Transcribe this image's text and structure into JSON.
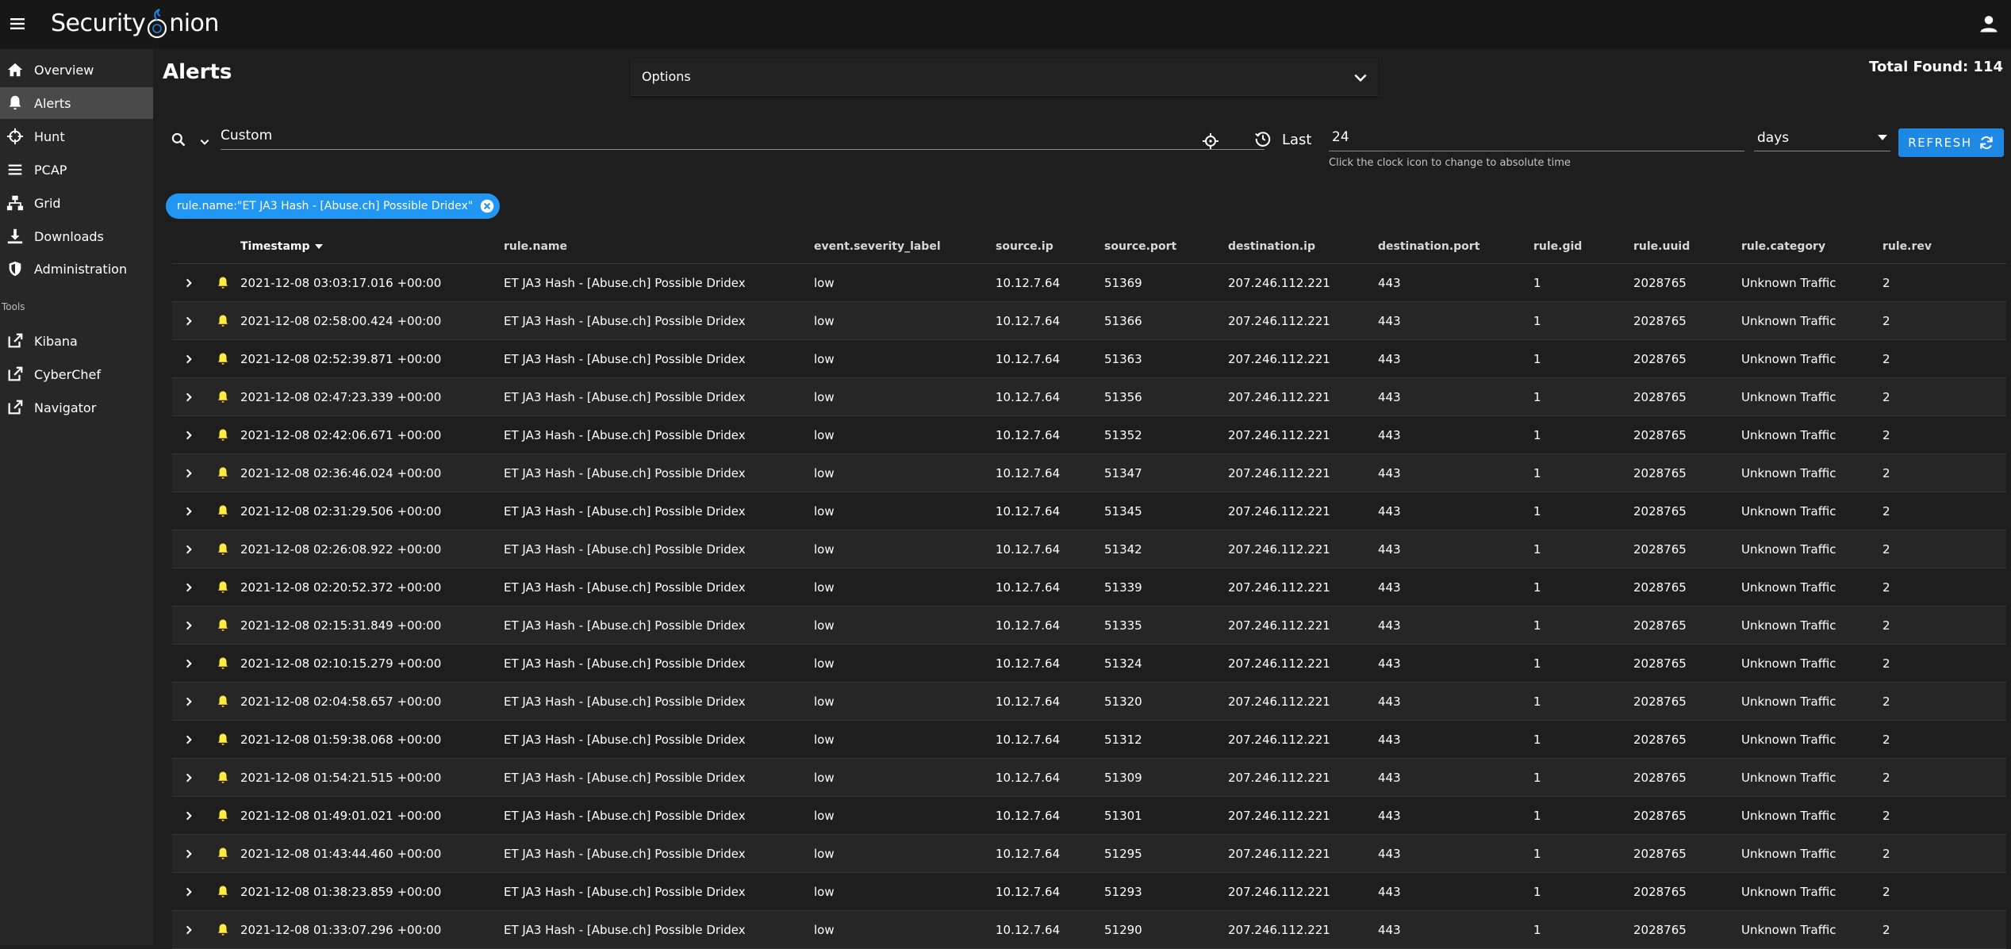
{
  "app": {
    "logo_text_left": "Security",
    "logo_text_right": "nion",
    "accent_color": "#1e88e5",
    "chip_color": "#2196f3",
    "bell_color": "#ffeb3b"
  },
  "sidebar": {
    "items": [
      {
        "label": "Overview",
        "icon": "home-icon"
      },
      {
        "label": "Alerts",
        "icon": "bell-icon",
        "active": true
      },
      {
        "label": "Hunt",
        "icon": "crosshairs-icon"
      },
      {
        "label": "PCAP",
        "icon": "list-icon"
      },
      {
        "label": "Grid",
        "icon": "sitemap-icon"
      },
      {
        "label": "Downloads",
        "icon": "download-icon"
      },
      {
        "label": "Administration",
        "icon": "shield-icon"
      }
    ],
    "tools_header": "Tools",
    "tools": [
      {
        "label": "Kibana",
        "icon": "external-link-icon"
      },
      {
        "label": "CyberChef",
        "icon": "external-link-icon"
      },
      {
        "label": "Navigator",
        "icon": "external-link-icon"
      }
    ]
  },
  "header": {
    "title": "Alerts",
    "options_label": "Options",
    "total_found": "Total Found: 114"
  },
  "query": {
    "value": "Custom",
    "last_label": "Last",
    "range_value": "24",
    "range_hint": "Click the clock icon to change to absolute time",
    "unit": "days",
    "refresh_label": "REFRESH"
  },
  "filter_chip": {
    "label": "rule.name:\"ET JA3 Hash - [Abuse.ch] Possible Dridex\""
  },
  "table": {
    "columns": [
      "Timestamp",
      "rule.name",
      "event.severity_label",
      "source.ip",
      "source.port",
      "destination.ip",
      "destination.port",
      "rule.gid",
      "rule.uuid",
      "rule.category",
      "rule.rev"
    ],
    "sorted_column": "Timestamp",
    "sort_direction": "descending",
    "rows": [
      [
        "2021-12-08 03:03:17.016 +00:00",
        "ET JA3 Hash - [Abuse.ch] Possible Dridex",
        "low",
        "10.12.7.64",
        "51369",
        "207.246.112.221",
        "443",
        "1",
        "2028765",
        "Unknown Traffic",
        "2"
      ],
      [
        "2021-12-08 02:58:00.424 +00:00",
        "ET JA3 Hash - [Abuse.ch] Possible Dridex",
        "low",
        "10.12.7.64",
        "51366",
        "207.246.112.221",
        "443",
        "1",
        "2028765",
        "Unknown Traffic",
        "2"
      ],
      [
        "2021-12-08 02:52:39.871 +00:00",
        "ET JA3 Hash - [Abuse.ch] Possible Dridex",
        "low",
        "10.12.7.64",
        "51363",
        "207.246.112.221",
        "443",
        "1",
        "2028765",
        "Unknown Traffic",
        "2"
      ],
      [
        "2021-12-08 02:47:23.339 +00:00",
        "ET JA3 Hash - [Abuse.ch] Possible Dridex",
        "low",
        "10.12.7.64",
        "51356",
        "207.246.112.221",
        "443",
        "1",
        "2028765",
        "Unknown Traffic",
        "2"
      ],
      [
        "2021-12-08 02:42:06.671 +00:00",
        "ET JA3 Hash - [Abuse.ch] Possible Dridex",
        "low",
        "10.12.7.64",
        "51352",
        "207.246.112.221",
        "443",
        "1",
        "2028765",
        "Unknown Traffic",
        "2"
      ],
      [
        "2021-12-08 02:36:46.024 +00:00",
        "ET JA3 Hash - [Abuse.ch] Possible Dridex",
        "low",
        "10.12.7.64",
        "51347",
        "207.246.112.221",
        "443",
        "1",
        "2028765",
        "Unknown Traffic",
        "2"
      ],
      [
        "2021-12-08 02:31:29.506 +00:00",
        "ET JA3 Hash - [Abuse.ch] Possible Dridex",
        "low",
        "10.12.7.64",
        "51345",
        "207.246.112.221",
        "443",
        "1",
        "2028765",
        "Unknown Traffic",
        "2"
      ],
      [
        "2021-12-08 02:26:08.922 +00:00",
        "ET JA3 Hash - [Abuse.ch] Possible Dridex",
        "low",
        "10.12.7.64",
        "51342",
        "207.246.112.221",
        "443",
        "1",
        "2028765",
        "Unknown Traffic",
        "2"
      ],
      [
        "2021-12-08 02:20:52.372 +00:00",
        "ET JA3 Hash - [Abuse.ch] Possible Dridex",
        "low",
        "10.12.7.64",
        "51339",
        "207.246.112.221",
        "443",
        "1",
        "2028765",
        "Unknown Traffic",
        "2"
      ],
      [
        "2021-12-08 02:15:31.849 +00:00",
        "ET JA3 Hash - [Abuse.ch] Possible Dridex",
        "low",
        "10.12.7.64",
        "51335",
        "207.246.112.221",
        "443",
        "1",
        "2028765",
        "Unknown Traffic",
        "2"
      ],
      [
        "2021-12-08 02:10:15.279 +00:00",
        "ET JA3 Hash - [Abuse.ch] Possible Dridex",
        "low",
        "10.12.7.64",
        "51324",
        "207.246.112.221",
        "443",
        "1",
        "2028765",
        "Unknown Traffic",
        "2"
      ],
      [
        "2021-12-08 02:04:58.657 +00:00",
        "ET JA3 Hash - [Abuse.ch] Possible Dridex",
        "low",
        "10.12.7.64",
        "51320",
        "207.246.112.221",
        "443",
        "1",
        "2028765",
        "Unknown Traffic",
        "2"
      ],
      [
        "2021-12-08 01:59:38.068 +00:00",
        "ET JA3 Hash - [Abuse.ch] Possible Dridex",
        "low",
        "10.12.7.64",
        "51312",
        "207.246.112.221",
        "443",
        "1",
        "2028765",
        "Unknown Traffic",
        "2"
      ],
      [
        "2021-12-08 01:54:21.515 +00:00",
        "ET JA3 Hash - [Abuse.ch] Possible Dridex",
        "low",
        "10.12.7.64",
        "51309",
        "207.246.112.221",
        "443",
        "1",
        "2028765",
        "Unknown Traffic",
        "2"
      ],
      [
        "2021-12-08 01:49:01.021 +00:00",
        "ET JA3 Hash - [Abuse.ch] Possible Dridex",
        "low",
        "10.12.7.64",
        "51301",
        "207.246.112.221",
        "443",
        "1",
        "2028765",
        "Unknown Traffic",
        "2"
      ],
      [
        "2021-12-08 01:43:44.460 +00:00",
        "ET JA3 Hash - [Abuse.ch] Possible Dridex",
        "low",
        "10.12.7.64",
        "51295",
        "207.246.112.221",
        "443",
        "1",
        "2028765",
        "Unknown Traffic",
        "2"
      ],
      [
        "2021-12-08 01:38:23.859 +00:00",
        "ET JA3 Hash - [Abuse.ch] Possible Dridex",
        "low",
        "10.12.7.64",
        "51293",
        "207.246.112.221",
        "443",
        "1",
        "2028765",
        "Unknown Traffic",
        "2"
      ],
      [
        "2021-12-08 01:33:07.296 +00:00",
        "ET JA3 Hash - [Abuse.ch] Possible Dridex",
        "low",
        "10.12.7.64",
        "51290",
        "207.246.112.221",
        "443",
        "1",
        "2028765",
        "Unknown Traffic",
        "2"
      ]
    ]
  }
}
